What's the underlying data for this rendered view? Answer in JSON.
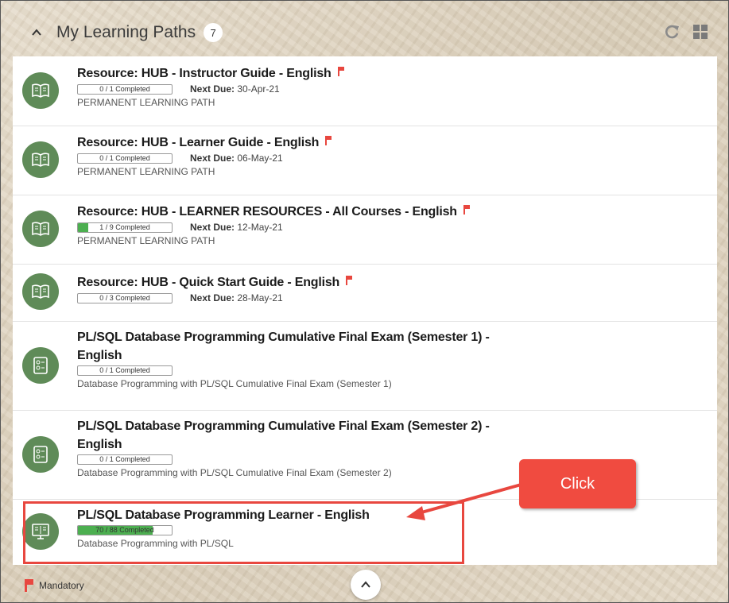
{
  "header": {
    "title": "My Learning Paths",
    "count": "7",
    "refresh_icon": "refresh-icon",
    "grid_icon": "grid-view-icon"
  },
  "items": [
    {
      "title": "Resource: HUB - Instructor Guide - English",
      "progress": "0 / 1 Completed",
      "progress_fraction": 0,
      "next_due_label": "Next Due:",
      "next_due": "30-Apr-21",
      "subtitle": "PERMANENT LEARNING PATH",
      "mandatory": true,
      "icon": "book-icon"
    },
    {
      "title": "Resource: HUB - Learner Guide - English",
      "progress": "0 / 1 Completed",
      "progress_fraction": 0,
      "next_due_label": "Next Due:",
      "next_due": "06-May-21",
      "subtitle": "PERMANENT LEARNING PATH",
      "mandatory": true,
      "icon": "book-icon"
    },
    {
      "title": "Resource: HUB - LEARNER RESOURCES - All Courses - English",
      "progress": "1 / 9 Completed",
      "progress_fraction": 0.11,
      "next_due_label": "Next Due:",
      "next_due": "12-May-21",
      "subtitle": "PERMANENT LEARNING PATH",
      "mandatory": true,
      "icon": "book-icon"
    },
    {
      "title": "Resource: HUB - Quick Start Guide - English",
      "progress": "0 / 3 Completed",
      "progress_fraction": 0,
      "next_due_label": "Next Due:",
      "next_due": "28-May-21",
      "subtitle": "",
      "mandatory": true,
      "icon": "book-icon"
    },
    {
      "title_line1": "PL/SQL Database Programming Cumulative Final Exam (Semester 1) -",
      "title_line2": "English",
      "progress": "0 / 1 Completed",
      "progress_fraction": 0,
      "subtitle": "Database Programming with PL/SQL Cumulative Final Exam (Semester 1)",
      "icon": "exam-icon"
    },
    {
      "title_line1": "PL/SQL Database Programming Cumulative Final Exam (Semester 2) -",
      "title_line2": "English",
      "progress": "0 / 1 Completed",
      "progress_fraction": 0,
      "subtitle": "Database Programming with PL/SQL Cumulative Final Exam (Semester 2)",
      "icon": "exam-icon"
    },
    {
      "title": "PL/SQL Database Programming Learner - English",
      "progress": "70 / 88 Completed",
      "progress_fraction": 0.795,
      "subtitle": "Database Programming with PL/SQL",
      "icon": "monitor-book-icon"
    }
  ],
  "callout": {
    "text": "Click"
  },
  "footer": {
    "legend_label": "Mandatory"
  },
  "colors": {
    "accent_green": "#5f8b58",
    "flag": "#e8473f",
    "progress_fill": "#4caf50",
    "callout": "#f04b40"
  }
}
